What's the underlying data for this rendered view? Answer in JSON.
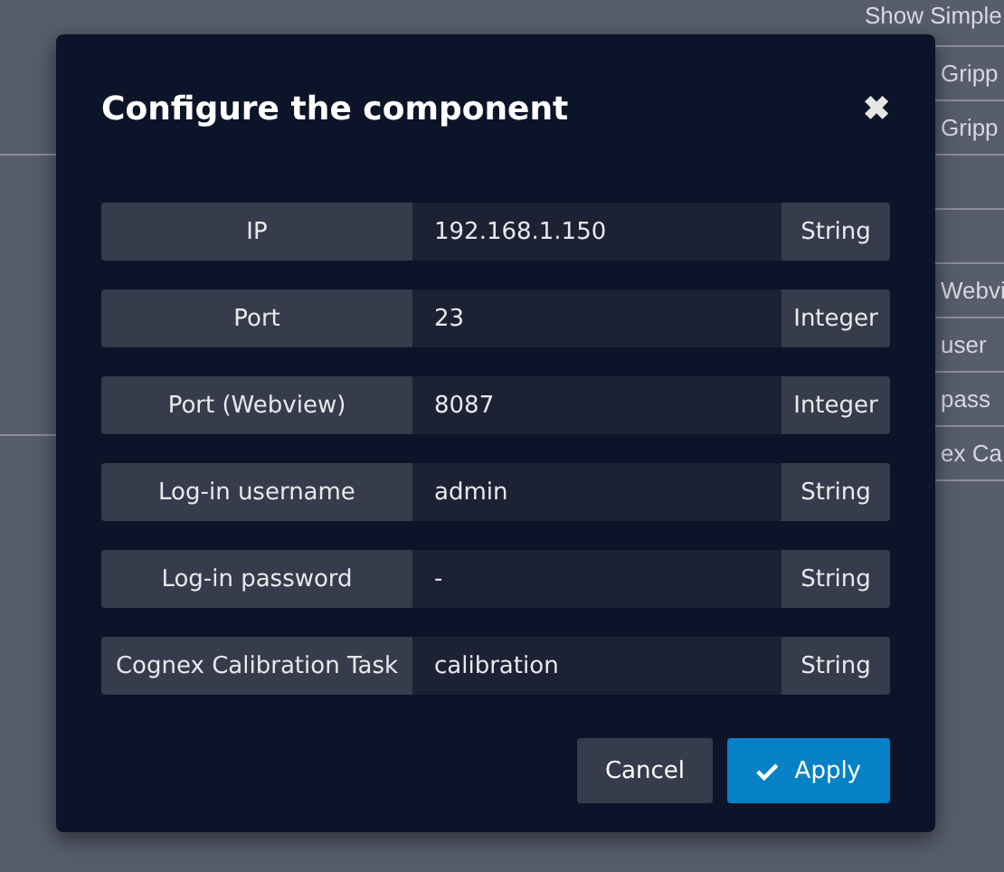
{
  "background": {
    "top_label": "Show Simple",
    "upper_items": [
      "Gripp",
      "Gripp"
    ],
    "lower_items": [
      "Webvi",
      "user",
      "pass",
      "ex Ca"
    ]
  },
  "dialog": {
    "title": "Configure the component",
    "close": "✖",
    "fields": [
      {
        "label": "IP",
        "value": "192.168.1.150",
        "type": "String"
      },
      {
        "label": "Port",
        "value": "23",
        "type": "Integer"
      },
      {
        "label": "Port (Webview)",
        "value": "8087",
        "type": "Integer"
      },
      {
        "label": "Log-in username",
        "value": "admin",
        "type": "String"
      },
      {
        "label": "Log-in password",
        "value": "-",
        "type": "String"
      },
      {
        "label": "Cognex Calibration Task",
        "value": "calibration",
        "type": "String"
      }
    ],
    "buttons": [
      {
        "label": "Cancel",
        "kind": "secondary"
      },
      {
        "label": "Apply",
        "kind": "primary"
      }
    ]
  }
}
